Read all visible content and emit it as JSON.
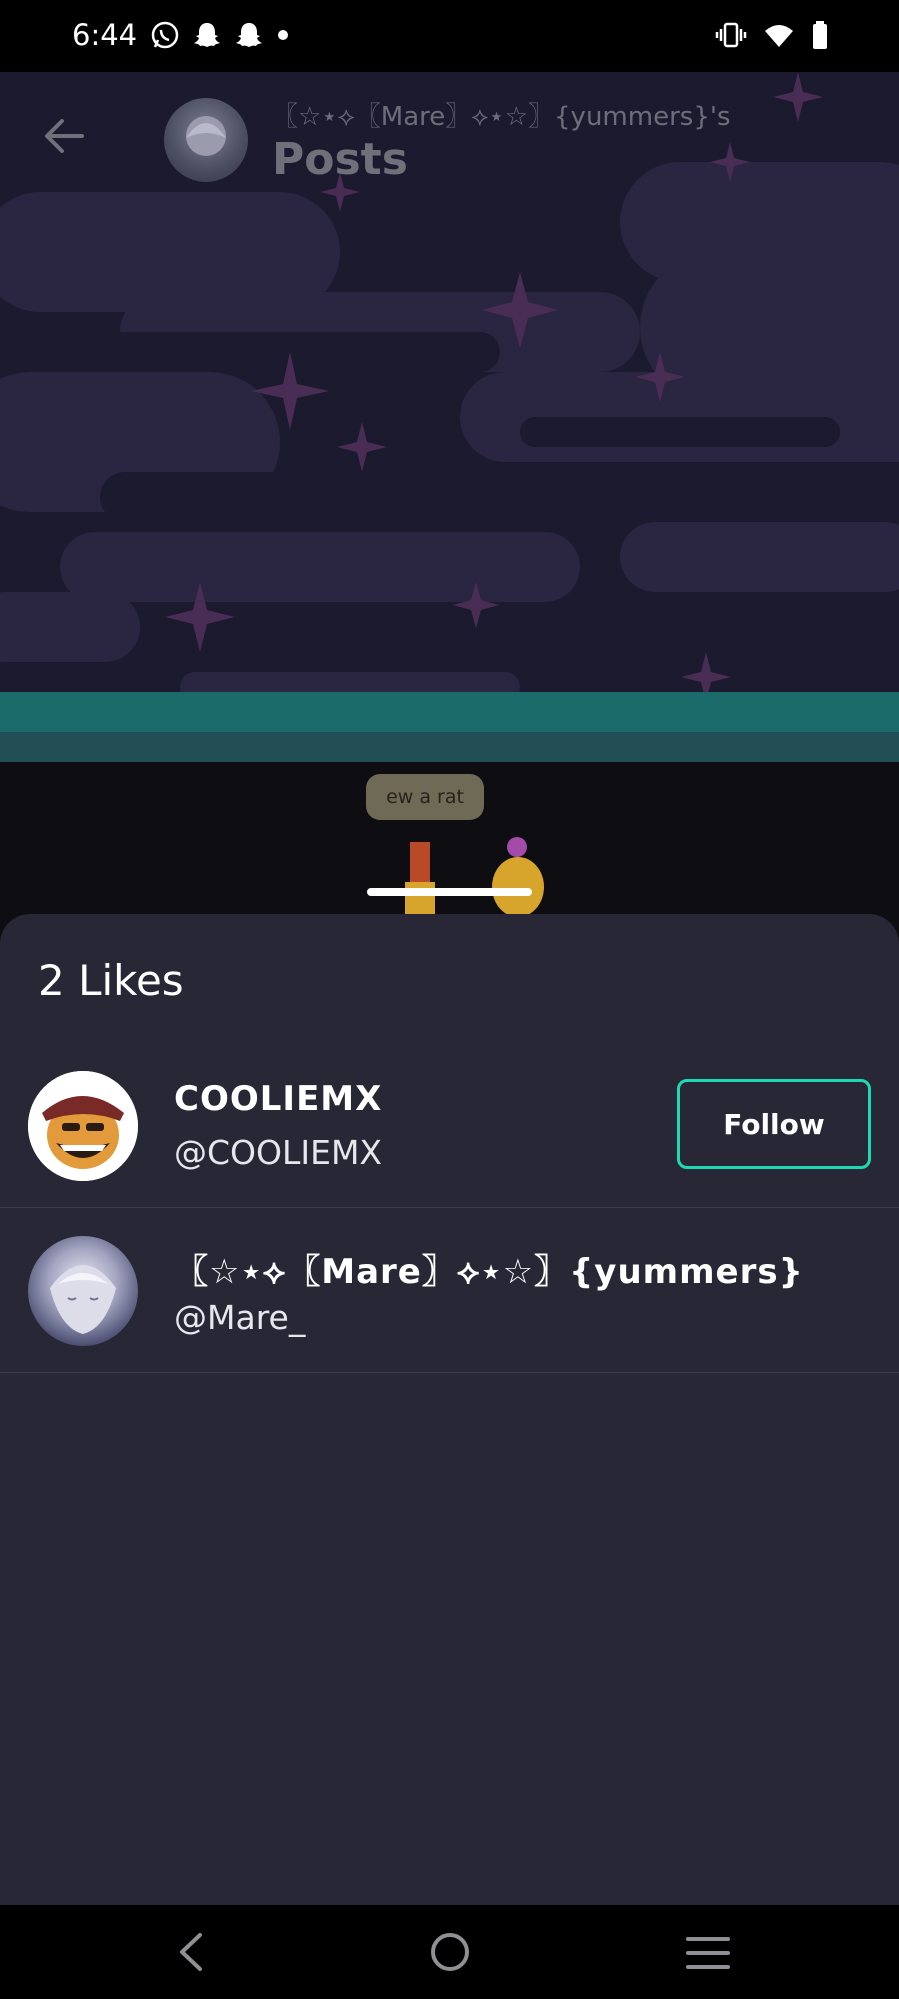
{
  "status_bar": {
    "time": "6:44",
    "left_icons": [
      "whatsapp-icon",
      "snapchat-icon",
      "snapchat-icon",
      "dot-icon"
    ],
    "right_icons": [
      "vibrate-icon",
      "wifi-icon",
      "battery-icon"
    ]
  },
  "header": {
    "subtitle": "〖☆⋆⟡〖Mare〗⟡⋆☆〗{yummers}'s",
    "title": "Posts"
  },
  "post": {
    "speech_bubble": "ew a rat"
  },
  "likes_sheet": {
    "title": "2 Likes",
    "users": [
      {
        "name": "COOLIEMX",
        "handle": "@COOLIEMX",
        "follow_label": "Follow"
      },
      {
        "name": "〖☆⋆⟡〖Mare〗⟡⋆☆〗{yummers}",
        "handle": "@Mare_"
      }
    ]
  },
  "colors": {
    "sheet_background": "#282736",
    "follow_border": "#1fd9b4",
    "background": "#1b1a2e"
  },
  "nav_bar": {
    "icons": [
      "back-nav-icon",
      "home-nav-icon",
      "recents-nav-icon"
    ]
  }
}
